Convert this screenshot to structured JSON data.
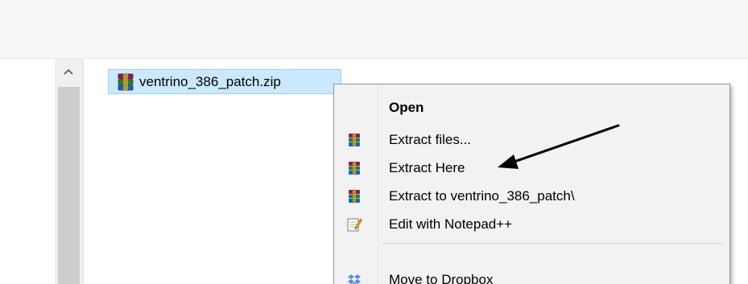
{
  "file_list": {
    "selected_file": {
      "name": "ventrino_386_patch.zip",
      "icon": "winrar-archive-icon"
    }
  },
  "context_menu": {
    "items": [
      {
        "label": "Open",
        "icon": "",
        "bold": true
      },
      {
        "label": "Extract files...",
        "icon": "winrar-icon"
      },
      {
        "label": "Extract Here",
        "icon": "winrar-icon"
      },
      {
        "label": "Extract to ventrino_386_patch\\",
        "icon": "winrar-icon"
      },
      {
        "label": "Edit with Notepad++",
        "icon": "notepad-plus-plus-icon"
      },
      {
        "label": "Move to Dropbox",
        "icon": "dropbox-icon"
      }
    ]
  },
  "colors": {
    "selection_fill": "#cce8ff",
    "selection_border": "#99d1ff",
    "menu_background": "#f2f2f2",
    "annotation_arrow": "#000000"
  }
}
